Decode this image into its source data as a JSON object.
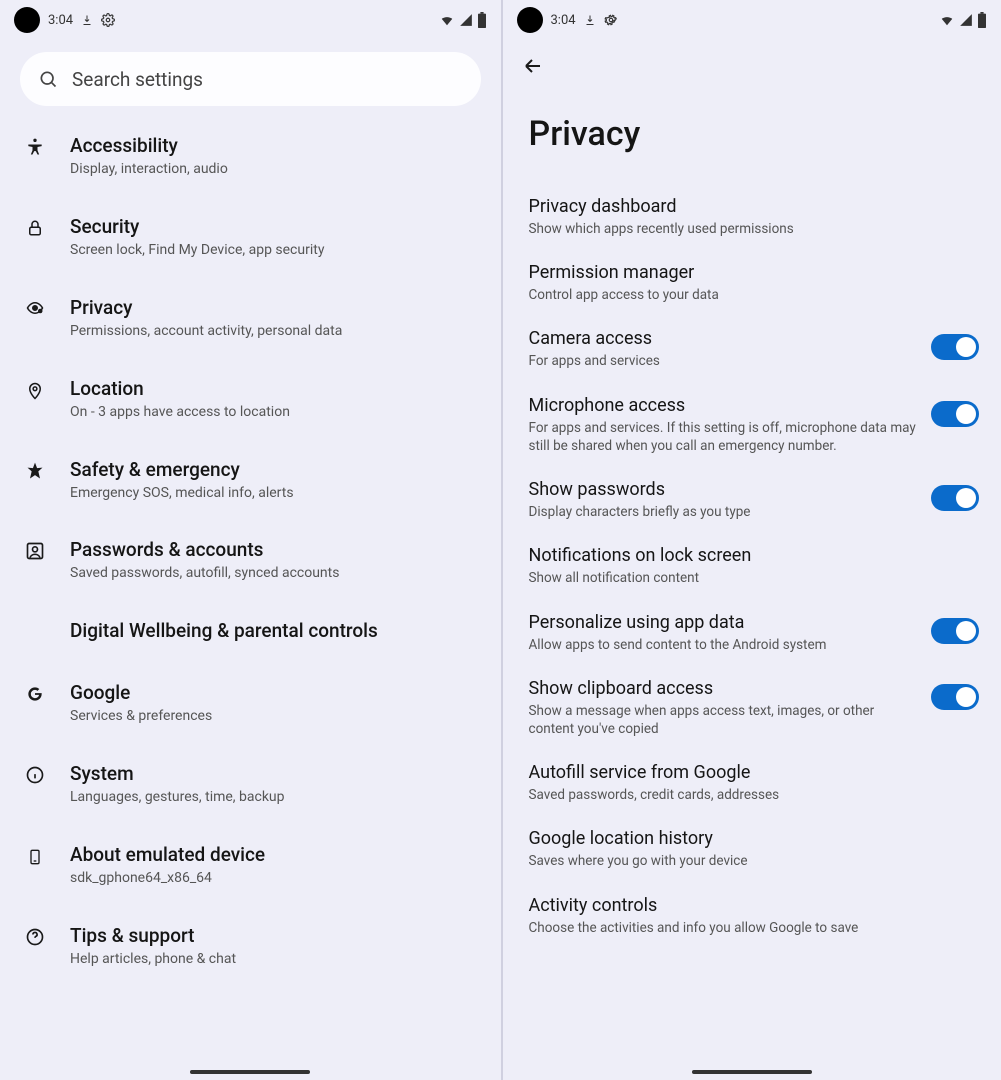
{
  "status": {
    "time": "3:04"
  },
  "search": {
    "placeholder": "Search settings"
  },
  "settings_items": [
    {
      "title": "Accessibility",
      "sub": "Display, interaction, audio"
    },
    {
      "title": "Security",
      "sub": "Screen lock, Find My Device, app security"
    },
    {
      "title": "Privacy",
      "sub": "Permissions, account activity, personal data"
    },
    {
      "title": "Location",
      "sub": "On - 3 apps have access to location"
    },
    {
      "title": "Safety & emergency",
      "sub": "Emergency SOS, medical info, alerts"
    },
    {
      "title": "Passwords & accounts",
      "sub": "Saved passwords, autofill, synced accounts"
    },
    {
      "title": "Digital Wellbeing & parental controls",
      "sub": ""
    },
    {
      "title": "Google",
      "sub": "Services & preferences"
    },
    {
      "title": "System",
      "sub": "Languages, gestures, time, backup"
    },
    {
      "title": "About emulated device",
      "sub": "sdk_gphone64_x86_64"
    },
    {
      "title": "Tips & support",
      "sub": "Help articles, phone & chat"
    }
  ],
  "privacy": {
    "page_title": "Privacy",
    "items": [
      {
        "title": "Privacy dashboard",
        "sub": "Show which apps recently used permissions",
        "toggle": false
      },
      {
        "title": "Permission manager",
        "sub": "Control app access to your data",
        "toggle": false
      },
      {
        "title": "Camera access",
        "sub": "For apps and services",
        "toggle": true
      },
      {
        "title": "Microphone access",
        "sub": "For apps and services. If this setting is off, microphone data may still be shared when you call an emergency number.",
        "toggle": true
      },
      {
        "title": "Show passwords",
        "sub": "Display characters briefly as you type",
        "toggle": true
      },
      {
        "title": "Notifications on lock screen",
        "sub": "Show all notification content",
        "toggle": false
      },
      {
        "title": "Personalize using app data",
        "sub": "Allow apps to send content to the Android system",
        "toggle": true
      },
      {
        "title": "Show clipboard access",
        "sub": "Show a message when apps access text, images, or other content you've copied",
        "toggle": true
      },
      {
        "title": "Autofill service from Google",
        "sub": "Saved passwords, credit cards, addresses",
        "toggle": false
      },
      {
        "title": "Google location history",
        "sub": "Saves where you go with your device",
        "toggle": false
      },
      {
        "title": "Activity controls",
        "sub": "Choose the activities and info you allow Google to save",
        "toggle": false
      }
    ]
  }
}
